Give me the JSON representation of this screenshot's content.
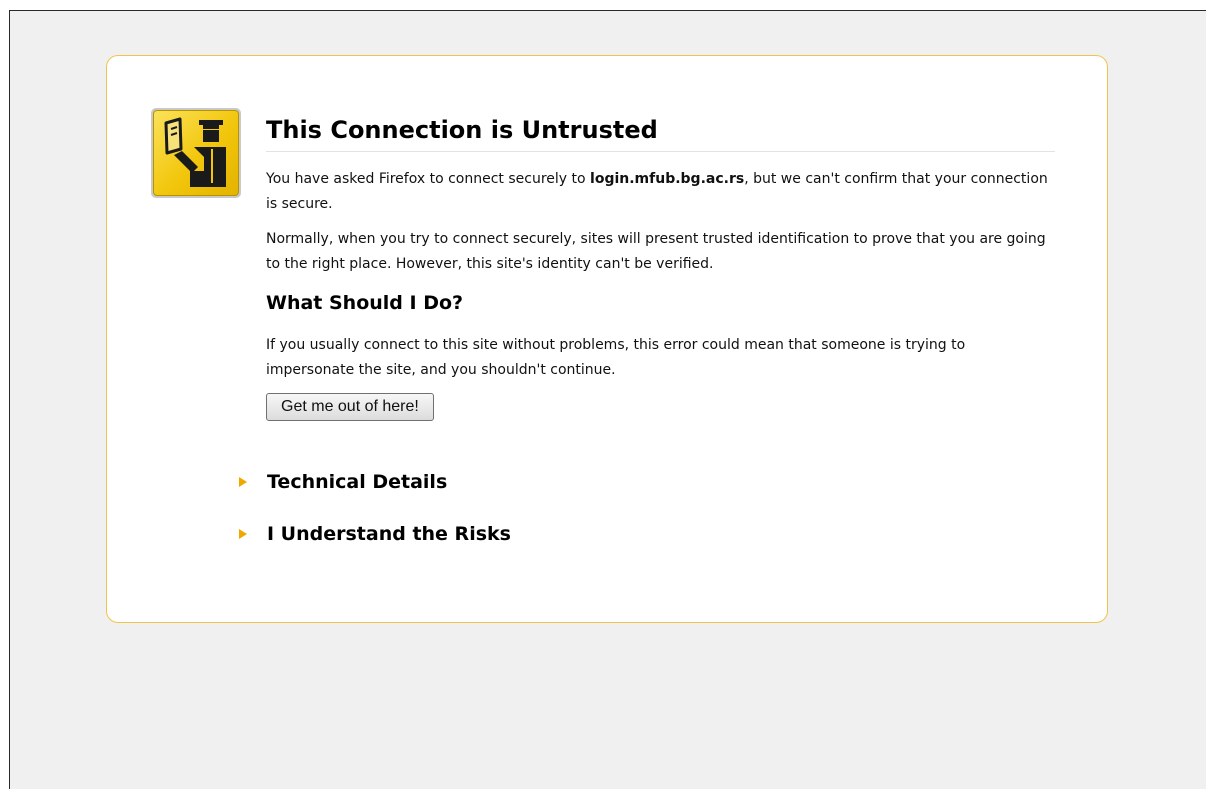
{
  "error_page": {
    "title": "This Connection is Untrusted",
    "intro": {
      "prefix": "You have asked Firefox to connect securely to ",
      "host": "login.mfub.bg.ac.rs",
      "suffix": ", but we can't confirm that your connection is secure."
    },
    "explanation": "Normally, when you try to connect securely, sites will present trusted identification to prove that you are going to the right place. However, this site's identity can't be verified.",
    "what_to_do_heading": "What Should I Do?",
    "advice": "If you usually connect to this site without problems, this error could mean that someone is trying to impersonate the site, and you shouldn't continue.",
    "escape_button_label": "Get me out of here!",
    "technical_details_label": "Technical Details",
    "understand_risks_label": "I Understand the Risks",
    "badge_icon": "identity-officer-icon",
    "expander_icon": "triangle-right-icon",
    "colors": {
      "box_border": "#f0c44c",
      "badge_yellow": "#f2c60c",
      "expander_triangle": "#f0a800",
      "page_background": "#f0f0f0"
    }
  }
}
